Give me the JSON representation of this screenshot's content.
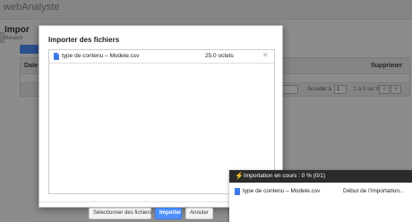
{
  "app": {
    "title": "webAnalyste"
  },
  "page": {
    "title": "Impor",
    "subtitle": "Revenir"
  },
  "background_table": {
    "columns": {
      "date": "Date",
      "delete": "Supprimer"
    },
    "pager": {
      "rows_value": "",
      "goto_label": "Accéder à",
      "page_value": "1",
      "range": "1 à 0 sur 0",
      "prev": "‹",
      "next": "›"
    }
  },
  "modal": {
    "title": "Importer des fichiers",
    "files": [
      {
        "name": "type de contenu – Modele.csv",
        "size": "25.0 octets",
        "remove_icon": "close-icon"
      }
    ],
    "buttons": {
      "select": "Sélectionner des fichiers",
      "import": "Importer",
      "cancel": "Annuler"
    }
  },
  "import_status": {
    "header": "Importation en cours : 0 % (0/1)",
    "items": [
      {
        "name": "type de contenu – Modele.csv",
        "state": "Début de l'importation..."
      }
    ]
  },
  "colors": {
    "primary": "#4d90fe",
    "status_header": "#2b2b2b",
    "file_icon": "#3b78e7"
  }
}
